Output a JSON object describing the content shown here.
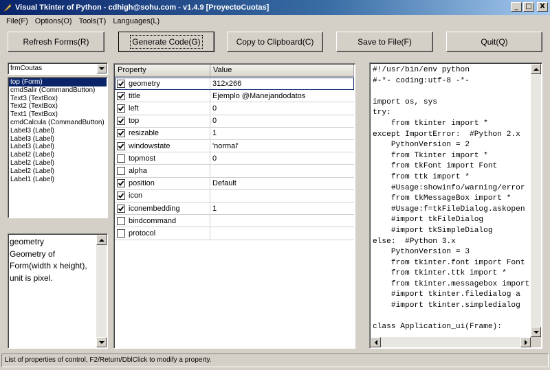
{
  "window": {
    "title": "Visual Tkinter of Python - cdhigh@sohu.com - v1.4.9 [ProyectoCuotas]",
    "minimize": "_",
    "maximize": "□",
    "close": "X"
  },
  "menu": [
    {
      "label": "File(F)"
    },
    {
      "label": "Options(O)"
    },
    {
      "label": "Tools(T)"
    },
    {
      "label": "Languages(L)"
    }
  ],
  "toolbar": {
    "refresh": "Refresh Forms(R)",
    "generate": "Generate Code(G)",
    "copy": "Copy to Clipboard(C)",
    "save": "Save to File(F)",
    "quit": "Quit(Q)"
  },
  "form_combo": {
    "value": "frmCoutas"
  },
  "controls": [
    "top (Form)",
    "cmdSalir (CommandButton)",
    "Text3 (TextBox)",
    "Text2 (TextBox)",
    "Text1 (TextBox)",
    "cmdCalcula (CommandButton)",
    "Label3 (Label)",
    "Label3 (Label)",
    "Label3 (Label)",
    "Label2 (Label)",
    "Label2 (Label)",
    "Label2 (Label)",
    "Label1 (Label)"
  ],
  "selected_control_index": 0,
  "description": "geometry\nGeometry of Form(width x height), unit is pixel.",
  "property_table": {
    "headers": {
      "property": "Property",
      "value": "Value"
    },
    "rows": [
      {
        "name": "geometry",
        "value": "312x266",
        "checked": true
      },
      {
        "name": "title",
        "value": "Ejemplo @Manejandodatos",
        "checked": true
      },
      {
        "name": "left",
        "value": "0",
        "checked": true
      },
      {
        "name": "top",
        "value": "0",
        "checked": true
      },
      {
        "name": "resizable",
        "value": "1",
        "checked": true
      },
      {
        "name": "windowstate",
        "value": "'normal'",
        "checked": true
      },
      {
        "name": "topmost",
        "value": "0",
        "checked": false
      },
      {
        "name": "alpha",
        "value": "",
        "checked": false
      },
      {
        "name": "position",
        "value": "Default",
        "checked": true
      },
      {
        "name": "icon",
        "value": "",
        "checked": true
      },
      {
        "name": "iconembedding",
        "value": "1",
        "checked": true
      },
      {
        "name": "bindcommand",
        "value": "",
        "checked": false
      },
      {
        "name": "protocol",
        "value": "",
        "checked": false
      }
    ]
  },
  "code": "#!/usr/bin/env python\n#-*- coding:utf-8 -*-\n\nimport os, sys\ntry:\n    from tkinter import *\nexcept ImportError:  #Python 2.x\n    PythonVersion = 2\n    from Tkinter import *\n    from tkFont import Font\n    from ttk import *\n    #Usage:showinfo/warning/error\n    from tkMessageBox import *\n    #Usage:f=tkFileDialog.askopen\n    #import tkFileDialog\n    #import tkSimpleDialog\nelse:  #Python 3.x\n    PythonVersion = 3\n    from tkinter.font import Font\n    from tkinter.ttk import *\n    from tkinter.messagebox import\n    #import tkinter.filedialog a\n    #import tkinter.simpledialog\n\nclass Application_ui(Frame):",
  "status": "List of properties of control, F2/Return/DblClick to modify a property."
}
